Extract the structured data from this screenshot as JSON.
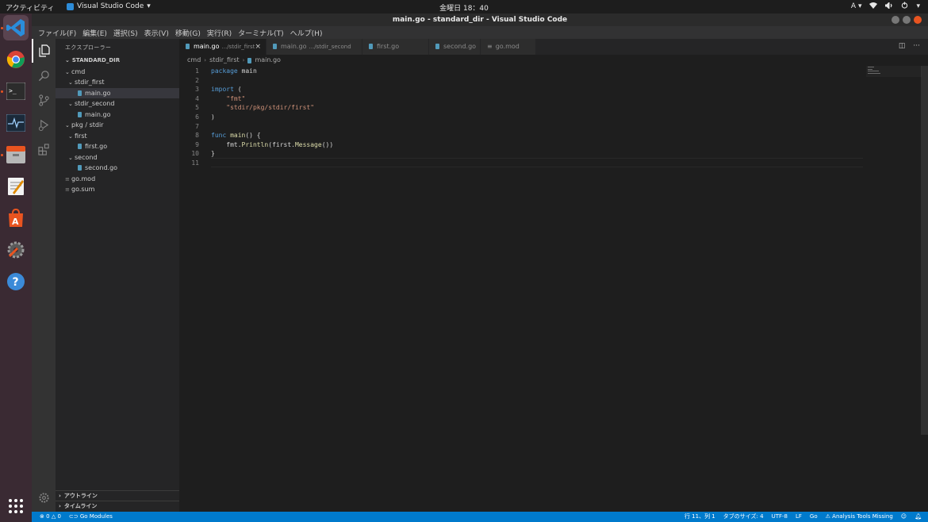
{
  "ubuntu": {
    "activities": "アクティビティ",
    "app_name": "Visual Studio Code",
    "clock": "金曜日 18：40",
    "input_method": "A"
  },
  "window": {
    "title": "main.go - standard_dir - Visual Studio Code"
  },
  "menu": [
    "ファイル(F)",
    "編集(E)",
    "選択(S)",
    "表示(V)",
    "移動(G)",
    "実行(R)",
    "ターミナル(T)",
    "ヘルプ(H)"
  ],
  "sidebar": {
    "title": "エクスプローラー",
    "root": "STANDARD_DIR",
    "tree": [
      {
        "label": "cmd",
        "type": "folder",
        "depth": 1
      },
      {
        "label": "stdir_first",
        "type": "folder",
        "depth": 2
      },
      {
        "label": "main.go",
        "type": "go",
        "depth": 3,
        "selected": true
      },
      {
        "label": "stdir_second",
        "type": "folder",
        "depth": 2
      },
      {
        "label": "main.go",
        "type": "go",
        "depth": 3
      },
      {
        "label": "pkg / stdir",
        "type": "folder",
        "depth": 1
      },
      {
        "label": "first",
        "type": "folder",
        "depth": 2
      },
      {
        "label": "first.go",
        "type": "go",
        "depth": 3
      },
      {
        "label": "second",
        "type": "folder",
        "depth": 2
      },
      {
        "label": "second.go",
        "type": "go",
        "depth": 3
      },
      {
        "label": "go.mod",
        "type": "mod",
        "depth": 1
      },
      {
        "label": "go.sum",
        "type": "mod",
        "depth": 1
      }
    ],
    "outline": "アウトライン",
    "timeline": "タイムライン"
  },
  "tabs": [
    {
      "label": "main.go",
      "desc": ".../stdir_first",
      "active": true
    },
    {
      "label": "main.go",
      "desc": ".../stdir_second",
      "active": false
    },
    {
      "label": "first.go",
      "desc": "",
      "active": false
    },
    {
      "label": "second.go",
      "desc": "",
      "active": false
    },
    {
      "label": "go.mod",
      "desc": "",
      "active": false
    }
  ],
  "breadcrumb": [
    "cmd",
    "stdir_first",
    "main.go"
  ],
  "code_lines": [
    [
      [
        "kw",
        "package"
      ],
      [
        "pl",
        " main"
      ]
    ],
    [],
    [
      [
        "kw",
        "import"
      ],
      [
        "pl",
        " ("
      ]
    ],
    [
      [
        "pl",
        "    "
      ],
      [
        "str",
        "\"fmt\""
      ]
    ],
    [
      [
        "pl",
        "    "
      ],
      [
        "str",
        "\"stdir/pkg/stdir/first\""
      ]
    ],
    [
      [
        "pl",
        ")"
      ]
    ],
    [],
    [
      [
        "kw",
        "func"
      ],
      [
        "pl",
        " "
      ],
      [
        "fn",
        "main"
      ],
      [
        "pl",
        "() {"
      ]
    ],
    [
      [
        "pl",
        "    fmt."
      ],
      [
        "fn",
        "Println"
      ],
      [
        "pl",
        "(first."
      ],
      [
        "fn",
        "Message"
      ],
      [
        "pl",
        "())"
      ]
    ],
    [
      [
        "pl",
        "}"
      ]
    ],
    []
  ],
  "status": {
    "errors": "0",
    "warnings": "0",
    "go_modules": "Go Modules",
    "position": "行 11、列 1",
    "tab_size": "タブのサイズ: 4",
    "encoding": "UTF-8",
    "eol": "LF",
    "language": "Go",
    "analysis": "Analysis Tools Missing"
  },
  "colors": {
    "statusbar": "#007acc",
    "keyword": "#569cd6",
    "string": "#ce9178",
    "function": "#dcdcaa",
    "go_icon": "#519aba"
  }
}
